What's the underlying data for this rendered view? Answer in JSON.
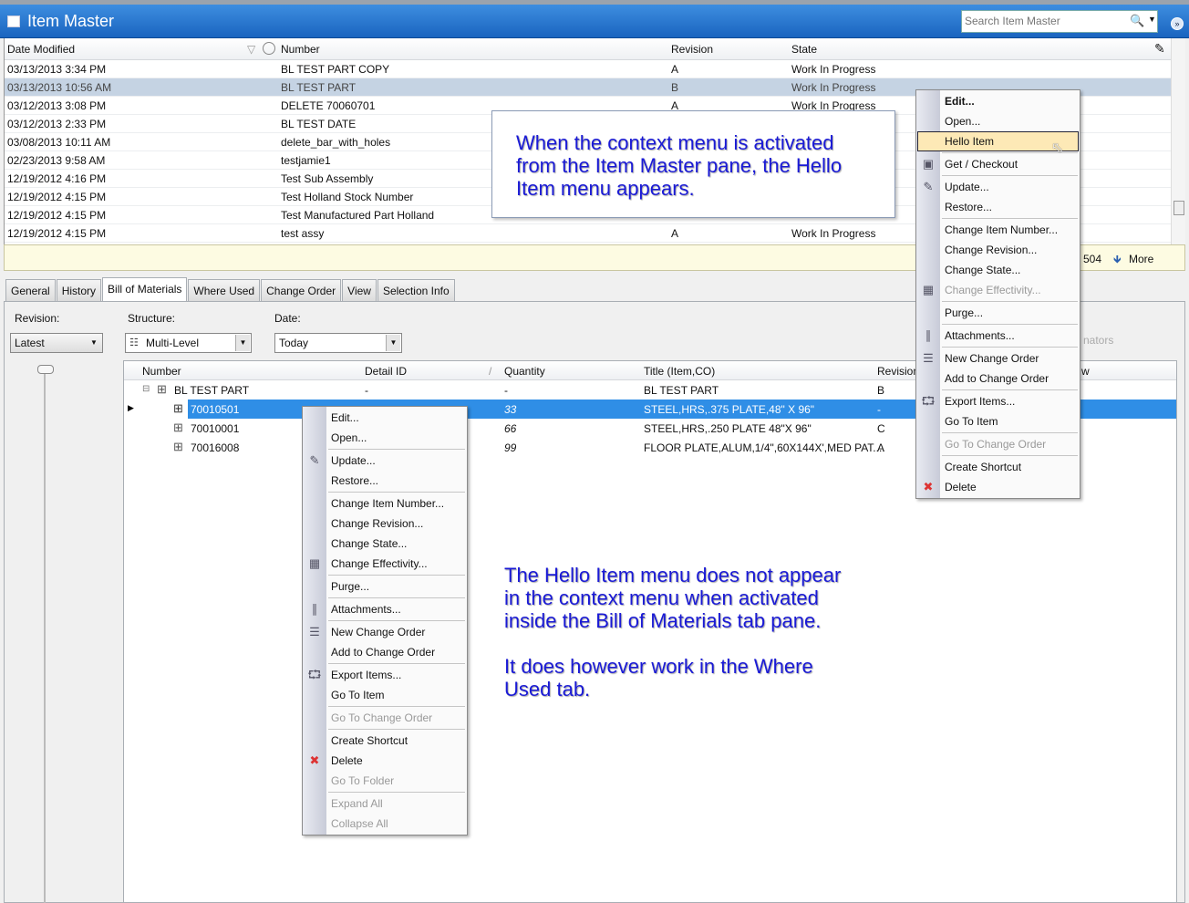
{
  "window": {
    "title": "Item Master",
    "search_placeholder": "Search Item Master"
  },
  "top_grid": {
    "columns": [
      "Date Modified",
      "Number",
      "Revision",
      "State"
    ],
    "rows": [
      [
        "03/13/2013 3:34 PM",
        "BL TEST PART COPY",
        "A",
        "Work In Progress"
      ],
      [
        "03/13/2013 10:56 AM",
        "BL TEST PART",
        "B",
        "Work In Progress"
      ],
      [
        "03/12/2013 3:08 PM",
        "DELETE 70060701",
        "A",
        "Work In Progress"
      ],
      [
        "03/12/2013 2:33 PM",
        "BL TEST DATE",
        "",
        ""
      ],
      [
        "03/08/2013 10:11 AM",
        "delete_bar_with_holes",
        "",
        ""
      ],
      [
        "02/23/2013 9:58 AM",
        "testjamie1",
        "",
        ""
      ],
      [
        "12/19/2012 4:16 PM",
        "Test Sub Assembly",
        "",
        ""
      ],
      [
        "12/19/2012 4:15 PM",
        "Test Holland Stock Number",
        "",
        ""
      ],
      [
        "12/19/2012 4:15 PM",
        "Test Manufactured Part Holland",
        "",
        ""
      ],
      [
        "12/19/2012 4:15 PM",
        "test assy",
        "A",
        "Work In Progress"
      ]
    ],
    "selected_row": 1
  },
  "status_bar": {
    "count": "504",
    "more_label": "More"
  },
  "tabs": [
    "General",
    "History",
    "Bill of Materials",
    "Where Used",
    "Change Order",
    "View",
    "Selection Info"
  ],
  "active_tab": 2,
  "bom_controls": {
    "revision_label": "Revision:",
    "revision_value": "Latest",
    "structure_label": "Structure:",
    "structure_value": "Multi-Level",
    "date_label": "Date:",
    "date_value": "Today",
    "hidden_text": "nators"
  },
  "bom_grid": {
    "columns": [
      "Number",
      "Detail ID",
      "Quantity",
      "Title (Item,CO)",
      "Revision",
      "w"
    ],
    "rows": [
      [
        "BL TEST PART",
        "-",
        "-",
        "BL TEST PART",
        "B"
      ],
      [
        "70010501",
        "",
        "33",
        "STEEL,HRS,.375 PLATE,48\" X 96\"",
        "-"
      ],
      [
        "70010001",
        "",
        "66",
        "STEEL,HRS,.250 PLATE 48\"X 96\"",
        "C"
      ],
      [
        "70016008",
        "",
        "99",
        "FLOOR PLATE,ALUM,1/4\",60X144X',MED PAT....",
        "A"
      ]
    ],
    "selected_row": 1
  },
  "menu_bom": [
    {
      "label": "Edit..."
    },
    {
      "label": "Open..."
    },
    {
      "sep": true
    },
    {
      "label": "Update...",
      "icon": "update-icon"
    },
    {
      "label": "Restore..."
    },
    {
      "sep": true
    },
    {
      "label": "Change Item Number..."
    },
    {
      "label": "Change Revision..."
    },
    {
      "label": "Change State..."
    },
    {
      "label": "Change Effectivity...",
      "icon": "calendar-icon"
    },
    {
      "sep": true
    },
    {
      "label": "Purge..."
    },
    {
      "sep": true
    },
    {
      "label": "Attachments...",
      "icon": "paperclip-icon"
    },
    {
      "sep": true
    },
    {
      "label": "New Change Order",
      "icon": "change-order-icon"
    },
    {
      "label": "Add to Change Order"
    },
    {
      "sep": true
    },
    {
      "label": "Export Items...",
      "icon": "export-icon"
    },
    {
      "label": "Go To Item"
    },
    {
      "sep": true
    },
    {
      "label": "Go To Change Order",
      "disabled": true
    },
    {
      "sep": true
    },
    {
      "label": "Create Shortcut"
    },
    {
      "label": "Delete",
      "icon": "delete-icon"
    },
    {
      "label": "Go To Folder",
      "disabled": true
    },
    {
      "sep": true
    },
    {
      "label": "Expand All",
      "disabled": true
    },
    {
      "label": "Collapse All",
      "disabled": true
    }
  ],
  "menu_master": [
    {
      "label": "Edit...",
      "bold": true
    },
    {
      "label": "Open..."
    },
    {
      "label": "Hello Item",
      "highlight": true
    },
    {
      "sep": true
    },
    {
      "label": "Get / Checkout",
      "icon": "checkout-icon"
    },
    {
      "sep": true
    },
    {
      "label": "Update...",
      "icon": "update-icon"
    },
    {
      "label": "Restore..."
    },
    {
      "sep": true
    },
    {
      "label": "Change Item Number..."
    },
    {
      "label": "Change Revision..."
    },
    {
      "label": "Change State..."
    },
    {
      "label": "Change Effectivity...",
      "icon": "calendar-icon",
      "disabled": true
    },
    {
      "sep": true
    },
    {
      "label": "Purge..."
    },
    {
      "sep": true
    },
    {
      "label": "Attachments...",
      "icon": "paperclip-icon"
    },
    {
      "sep": true
    },
    {
      "label": "New Change Order",
      "icon": "change-order-icon"
    },
    {
      "label": "Add to Change Order"
    },
    {
      "sep": true
    },
    {
      "label": "Export Items...",
      "icon": "export-icon"
    },
    {
      "label": "Go To Item"
    },
    {
      "sep": true
    },
    {
      "label": "Go To Change Order",
      "disabled": true
    },
    {
      "sep": true
    },
    {
      "label": "Create Shortcut"
    },
    {
      "label": "Delete",
      "icon": "delete-icon"
    }
  ],
  "annotations": {
    "callout": [
      "When the context menu is activated",
      "from the Item Master pane, the Hello",
      "Item menu appears."
    ],
    "note": [
      "The Hello Item menu does not appear",
      "in the context menu when activated",
      "inside the Bill of Materials tab pane.",
      "",
      "It does however work in the Where",
      "Used tab."
    ]
  },
  "colors": {
    "title_bar": "#1a64bf",
    "selection": "#2f8ee6",
    "highlight": "#fde9b6",
    "annotation": "#1a1ad6"
  }
}
